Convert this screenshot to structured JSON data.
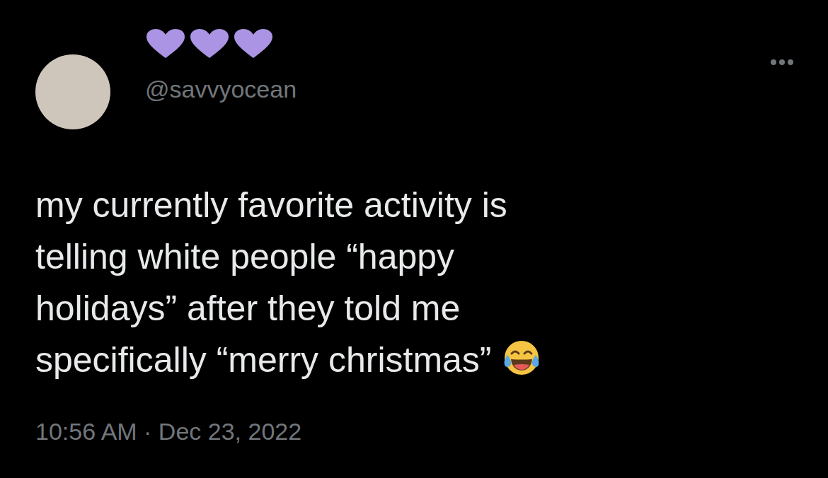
{
  "author": {
    "handle": "@savvyocean"
  },
  "tweet": {
    "lines": [
      "my currently favorite activity is",
      "telling white people “happy",
      "holidays” after they told me",
      "specifically “merry christmas”"
    ]
  },
  "timestamp": "10:56 AM · Dec 23, 2022"
}
